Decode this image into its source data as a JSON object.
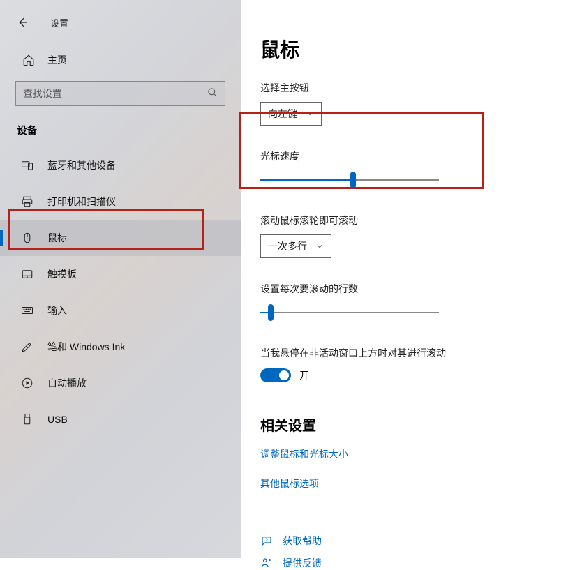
{
  "topbar": {
    "title": "设置"
  },
  "sidebar": {
    "home_label": "主页",
    "search_placeholder": "查找设置",
    "group_header": "设备",
    "items": [
      {
        "id": "bluetooth",
        "label": "蓝牙和其他设备",
        "icon": "devices-icon",
        "selected": false
      },
      {
        "id": "printers",
        "label": "打印机和扫描仪",
        "icon": "printer-icon",
        "selected": false
      },
      {
        "id": "mouse",
        "label": "鼠标",
        "icon": "mouse-icon",
        "selected": true
      },
      {
        "id": "touchpad",
        "label": "触摸板",
        "icon": "touchpad-icon",
        "selected": false
      },
      {
        "id": "typing",
        "label": "输入",
        "icon": "keyboard-icon",
        "selected": false
      },
      {
        "id": "pen",
        "label": "笔和 Windows Ink",
        "icon": "pen-icon",
        "selected": false
      },
      {
        "id": "autoplay",
        "label": "自动播放",
        "icon": "autoplay-icon",
        "selected": false
      },
      {
        "id": "usb",
        "label": "USB",
        "icon": "usb-icon",
        "selected": false
      }
    ]
  },
  "main": {
    "page_title": "鼠标",
    "primary_button": {
      "label": "选择主按钮",
      "value": "向左键"
    },
    "cursor_speed": {
      "label": "光标速度",
      "value": 52,
      "min": 0,
      "max": 100
    },
    "scroll_wheel": {
      "label": "滚动鼠标滚轮即可滚动",
      "value": "一次多行"
    },
    "lines_per_scroll": {
      "label": "设置每次要滚动的行数",
      "value": 6,
      "min": 0,
      "max": 100
    },
    "hover_scroll": {
      "label": "当我悬停在非活动窗口上方时对其进行滚动",
      "state_label": "开",
      "state": true
    },
    "related": {
      "header": "相关设置",
      "links": [
        "调整鼠标和光标大小",
        "其他鼠标选项"
      ]
    },
    "help": {
      "get_help": "获取帮助",
      "feedback": "提供反馈"
    }
  },
  "colors": {
    "accent": "#0067c0",
    "annotation": "#b52118"
  }
}
